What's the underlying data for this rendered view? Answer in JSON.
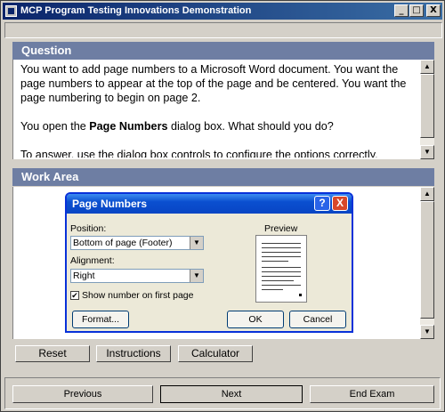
{
  "window": {
    "title": "MCP Program Testing Innovations Demonstration",
    "minimize": "_",
    "maximize": "□",
    "close": "X"
  },
  "question": {
    "header": "Question",
    "paragraph1": "You want to add page numbers to a Microsoft Word document. You want the page numbers to appear at the top of the page and be centered. You want the page numbering to begin on page 2.",
    "paragraph2_pre": "You open the ",
    "paragraph2_bold": "Page Numbers",
    "paragraph2_post": " dialog box. What should you do?",
    "paragraph3": "To answer, use the dialog box controls to configure the options correctly."
  },
  "work_area": {
    "header": "Work Area"
  },
  "dialog": {
    "title": "Page Numbers",
    "help_button": "?",
    "close_button": "X",
    "position_label": "Position:",
    "position_value": "Bottom of page (Footer)",
    "alignment_label": "Alignment:",
    "alignment_value": "Right",
    "show_first_page_label": "Show number on first page",
    "show_first_page_checked": true,
    "preview_label": "Preview",
    "format_button": "Format...",
    "ok_button": "OK",
    "cancel_button": "Cancel"
  },
  "toolbar": {
    "reset": "Reset",
    "instructions": "Instructions",
    "calculator": "Calculator"
  },
  "navigation": {
    "previous": "Previous",
    "next": "Next",
    "end_exam": "End Exam"
  },
  "colors": {
    "title_bar": "#0a246a",
    "section_header": "#6e7ea3",
    "dialog_title": "#0a4fd0",
    "face": "#d4d0c8"
  }
}
